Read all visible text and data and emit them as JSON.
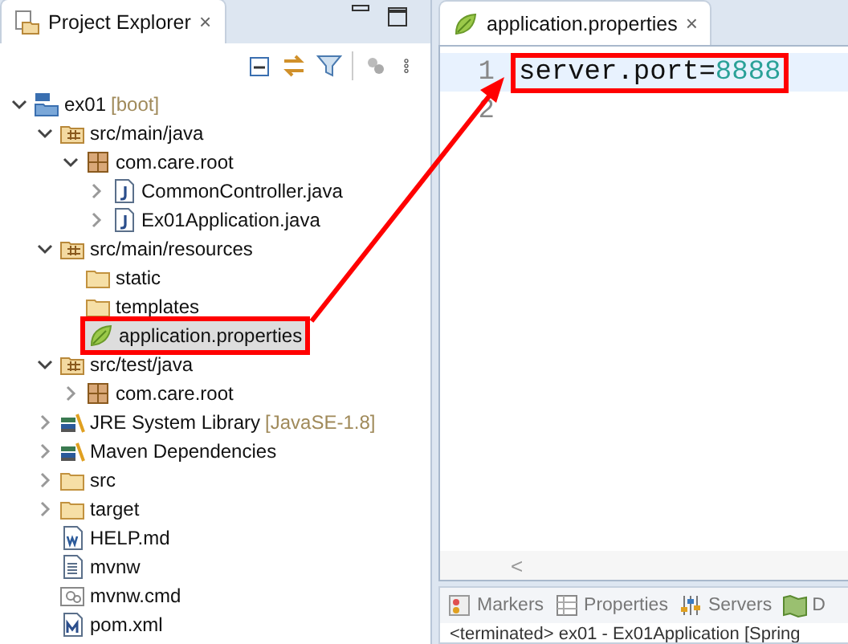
{
  "explorer": {
    "title": "Project Explorer",
    "close": "×",
    "tree": [
      {
        "label": "ex01",
        "decoration": "[boot]",
        "kind": "project",
        "expanded": true,
        "highlighted": false,
        "children": [
          {
            "label": "src/main/java",
            "kind": "source-folder",
            "expanded": true,
            "highlighted": false,
            "children": [
              {
                "label": "com.care.root",
                "kind": "package",
                "expanded": true,
                "highlighted": false,
                "children": [
                  {
                    "label": "CommonController.java",
                    "kind": "java-file",
                    "expanded": false,
                    "highlighted": false
                  },
                  {
                    "label": "Ex01Application.java",
                    "kind": "java-file",
                    "expanded": false,
                    "highlighted": false
                  }
                ]
              }
            ]
          },
          {
            "label": "src/main/resources",
            "kind": "source-folder",
            "expanded": true,
            "highlighted": false,
            "children": [
              {
                "label": "static",
                "kind": "folder",
                "highlighted": false
              },
              {
                "label": "templates",
                "kind": "folder",
                "highlighted": false
              },
              {
                "label": "application.properties",
                "kind": "properties-file",
                "highlighted": true
              }
            ]
          },
          {
            "label": "src/test/java",
            "kind": "source-folder",
            "expanded": true,
            "highlighted": false,
            "children": [
              {
                "label": "com.care.root",
                "kind": "package",
                "expanded": false,
                "highlighted": false
              }
            ]
          },
          {
            "label": "JRE System Library",
            "decoration": "[JavaSE-1.8]",
            "kind": "library",
            "expanded": false,
            "highlighted": false
          },
          {
            "label": "Maven Dependencies",
            "kind": "library",
            "expanded": false,
            "highlighted": false
          },
          {
            "label": "src",
            "kind": "folder",
            "expanded": false,
            "highlighted": false
          },
          {
            "label": "target",
            "kind": "folder",
            "expanded": false,
            "highlighted": false
          },
          {
            "label": "HELP.md",
            "kind": "word-file",
            "highlighted": false
          },
          {
            "label": "mvnw",
            "kind": "text-file",
            "highlighted": false
          },
          {
            "label": "mvnw.cmd",
            "kind": "cmd-file",
            "highlighted": false
          },
          {
            "label": "pom.xml",
            "kind": "maven-file",
            "highlighted": false
          }
        ]
      }
    ]
  },
  "editor": {
    "tab": {
      "label": "application.properties",
      "close": "×"
    },
    "lines": [
      {
        "number": "1",
        "key": "server.port",
        "separator": "=",
        "value": "8888",
        "current": true,
        "highlighted": true
      },
      {
        "number": "2",
        "current": false
      }
    ],
    "scroll_left": "<"
  },
  "bottom_panel": {
    "tabs": [
      {
        "label": "Markers",
        "kind": "markers"
      },
      {
        "label": "Properties",
        "kind": "properties"
      },
      {
        "label": "Servers",
        "kind": "servers"
      },
      {
        "label": "D",
        "kind": "data"
      }
    ],
    "console": "<terminated> ex01 - Ex01Application [Spring"
  }
}
